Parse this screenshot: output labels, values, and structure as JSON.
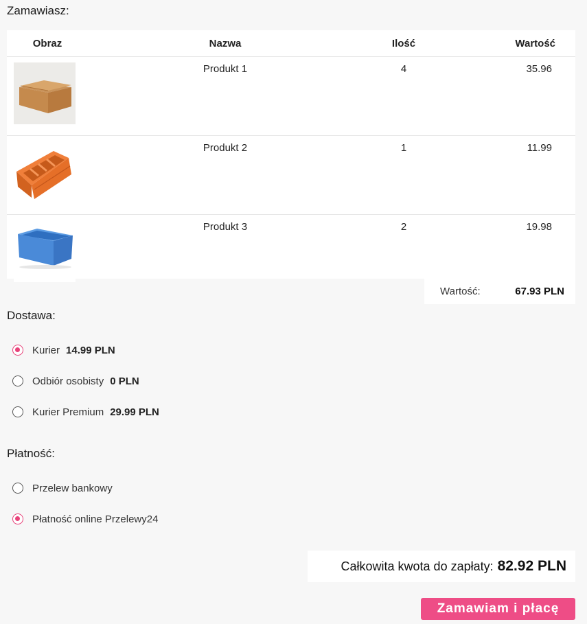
{
  "order": {
    "title": "Zamawiasz:",
    "columns": {
      "image": "Obraz",
      "name": "Nazwa",
      "qty": "Ilość",
      "value": "Wartość"
    },
    "items": [
      {
        "name": "Produkt 1",
        "qty": "4",
        "value": "35.96",
        "image_icon": "cardboard-box-icon"
      },
      {
        "name": "Produkt 2",
        "qty": "1",
        "value": "11.99",
        "image_icon": "orange-storage-bin-icon"
      },
      {
        "name": "Produkt 3",
        "qty": "2",
        "value": "19.98",
        "image_icon": "blue-container-icon"
      }
    ],
    "subtotal_label": "Wartość:",
    "subtotal_value": "67.93 PLN"
  },
  "delivery": {
    "title": "Dostawa:",
    "options": [
      {
        "label": "Kurier",
        "price": "14.99 PLN",
        "selected": true
      },
      {
        "label": "Odbiór osobisty",
        "price": "0 PLN",
        "selected": false
      },
      {
        "label": "Kurier Premium",
        "price": "29.99 PLN",
        "selected": false
      }
    ]
  },
  "payment": {
    "title": "Płatność:",
    "options": [
      {
        "label": "Przelew bankowy",
        "selected": false
      },
      {
        "label": "Płatność online Przelewy24",
        "selected": true
      }
    ]
  },
  "total": {
    "label": "Całkowita kwota do zapłaty:",
    "value": "82.92 PLN"
  },
  "submit_label": "Zamawiam i płacę",
  "colors": {
    "accent": "#ee4d86",
    "radio_checked": "#e8437a",
    "background": "#f7f7f7"
  }
}
